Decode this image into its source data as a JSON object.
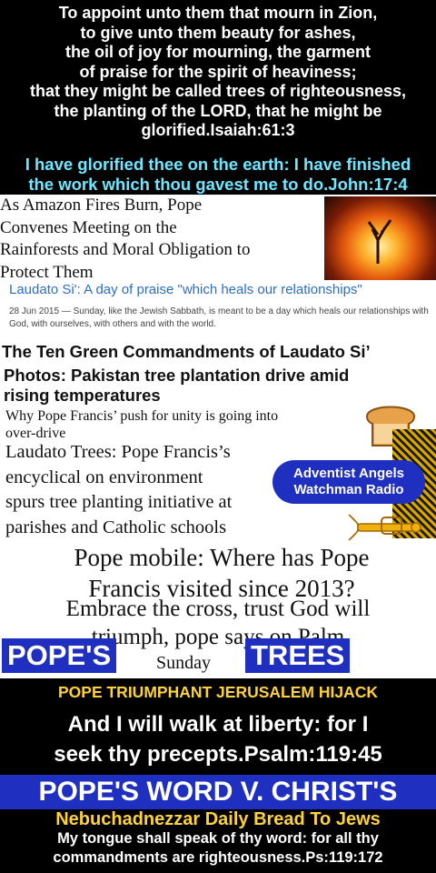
{
  "top_verse": {
    "line1": "To appoint unto them that mourn in Zion,",
    "line2": "to give unto them beauty for ashes,",
    "line3": "the oil of joy for mourning, the garment",
    "line4": "of praise for the spirit of heaviness;",
    "line5": "that they might be called trees of righteousness,",
    "line6": "the planting of the LORD, that he might be",
    "line7": "glorified.Isaiah:61:3"
  },
  "john_verse": {
    "line1": "I have glorified thee on the earth: I have finished",
    "line2": "the work which thou gavest me to do.John:17:4"
  },
  "headlines": {
    "amazon_line1": "As Amazon Fires Burn, Pope",
    "amazon_line2": "Convenes Meeting on the",
    "amazon_line3": "Rainforests and Moral Obligation to",
    "amazon_line4": "Protect Them",
    "laudato_day_title": "Laudato Si': A day of praise \"which heals our relationships\"",
    "laudato_day_desc": "28 Jun 2015 — Sunday, like the Jewish Sabbath, is meant to be a day which heals our relationships with God, with ourselves, with others and with the world.",
    "ten_green": "The Ten Green Commandments of Laudato Si’",
    "pakistan_line1": "Photos: Pakistan tree plantation drive amid",
    "pakistan_line2": "rising temperatures",
    "why_pope_line1": "Why Pope Francis’ push for unity is going into",
    "why_pope_line2": "over-drive",
    "laudato_trees_line1": "Laudato Trees: Pope Francis’s",
    "laudato_trees_line2": "encyclical on environment",
    "laudato_trees_line3": "spurs tree planting initiative at",
    "laudato_trees_line4": "parishes and Catholic schools",
    "mobile_line1": "Pope mobile: Where has Pope",
    "mobile_line2": "Francis visited since 2013?",
    "embrace_line1": "Embrace the cross, trust God will",
    "embrace_line2": "triumph, pope says on Palm",
    "embrace_line3": "Sunday"
  },
  "radio_bubble": {
    "line1": "Adventist Angels",
    "line2": "Watchman Radio"
  },
  "labels": {
    "popes": "POPE'S",
    "trees": "TREES",
    "hijack": "POPE TRIUMPHANT JERUSALEM HIJACK",
    "word_banner": "POPE'S WORD V. CHRIST'S",
    "nebuchadnezzar": "Nebuchadnezzar Daily Bread To Jews"
  },
  "psalm_119_45": {
    "line1": "And I will walk at liberty: for I",
    "line2": "seek thy precepts.Psalm:119:45"
  },
  "psalm_119_172": {
    "line1": "My tongue shall speak of thy word: for all thy",
    "line2": "commandments are righteousness.Ps:119:172"
  },
  "colors": {
    "background": "#000000",
    "cyan_text": "#6fe6ff",
    "yellow_text": "#ffd23a",
    "blue_banner": "#1f2fbf",
    "link_blue": "#2d6fc4"
  },
  "icons": [
    "fire-tree-image",
    "bread-icon",
    "trumpet-icon",
    "mosaic-image"
  ]
}
